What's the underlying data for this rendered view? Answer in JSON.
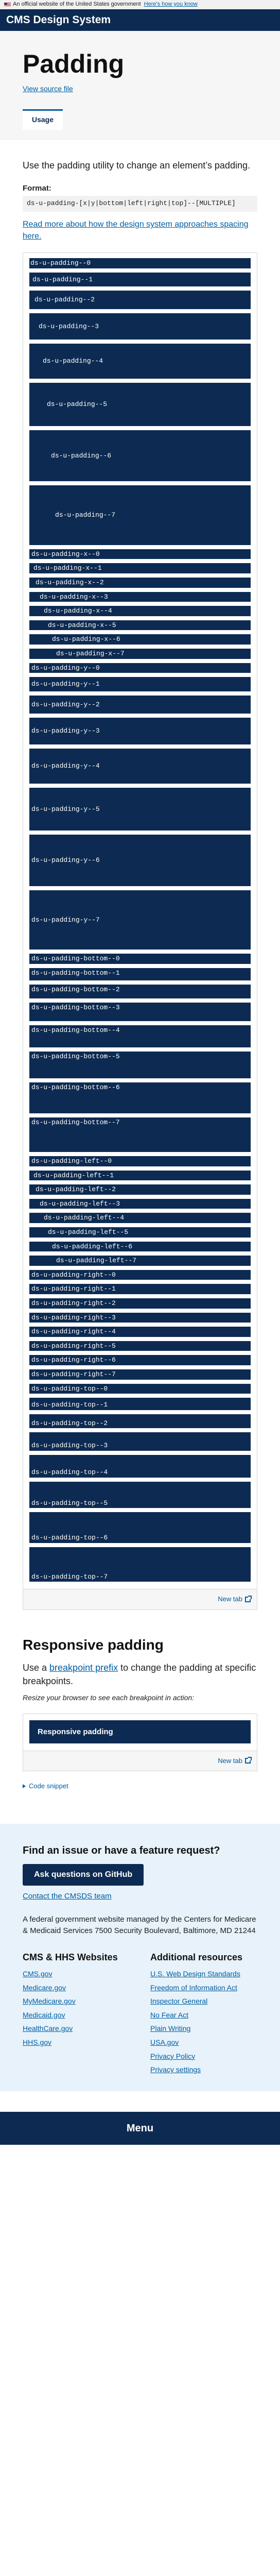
{
  "banner": {
    "text": "An official website of the United States government",
    "link": "Here's how you know"
  },
  "header": {
    "title": "CMS Design System"
  },
  "page": {
    "title": "Padding",
    "source_link": "View source file",
    "tab": "Usage"
  },
  "intro": {
    "lead": "Use the padding utility to change an element’s padding.",
    "format_label": "Format:",
    "format_code": "ds-u-padding-[x|y|bottom|left|right|top]--[MULTIPLE]",
    "approach_link": "Read more about how the design system approaches spacing here."
  },
  "demos": {
    "all": [
      "ds-u-padding--0",
      "ds-u-padding--1",
      "ds-u-padding--2",
      "ds-u-padding--3",
      "ds-u-padding--4",
      "ds-u-padding--5",
      "ds-u-padding--6",
      "ds-u-padding--7"
    ],
    "x": [
      "ds-u-padding-x--0",
      "ds-u-padding-x--1",
      "ds-u-padding-x--2",
      "ds-u-padding-x--3",
      "ds-u-padding-x--4",
      "ds-u-padding-x--5",
      "ds-u-padding-x--6",
      "ds-u-padding-x--7"
    ],
    "y": [
      "ds-u-padding-y--0",
      "ds-u-padding-y--1",
      "ds-u-padding-y--2",
      "ds-u-padding-y--3",
      "ds-u-padding-y--4",
      "ds-u-padding-y--5",
      "ds-u-padding-y--6",
      "ds-u-padding-y--7"
    ],
    "bottom": [
      "ds-u-padding-bottom--0",
      "ds-u-padding-bottom--1",
      "ds-u-padding-bottom--2",
      "ds-u-padding-bottom--3",
      "ds-u-padding-bottom--4",
      "ds-u-padding-bottom--5",
      "ds-u-padding-bottom--6",
      "ds-u-padding-bottom--7"
    ],
    "left": [
      "ds-u-padding-left--0",
      "ds-u-padding-left--1",
      "ds-u-padding-left--2",
      "ds-u-padding-left--3",
      "ds-u-padding-left--4",
      "ds-u-padding-left--5",
      "ds-u-padding-left--6",
      "ds-u-padding-left--7"
    ],
    "right": [
      "ds-u-padding-right--0",
      "ds-u-padding-right--1",
      "ds-u-padding-right--2",
      "ds-u-padding-right--3",
      "ds-u-padding-right--4",
      "ds-u-padding-right--5",
      "ds-u-padding-right--6",
      "ds-u-padding-right--7"
    ],
    "top": [
      "ds-u-padding-top--0",
      "ds-u-padding-top--1",
      "ds-u-padding-top--2",
      "ds-u-padding-top--3",
      "ds-u-padding-top--4",
      "ds-u-padding-top--5",
      "ds-u-padding-top--6",
      "ds-u-padding-top--7"
    ]
  },
  "example": {
    "new_tab": "New tab"
  },
  "responsive": {
    "heading": "Responsive padding",
    "lead_before": "Use a ",
    "lead_link": "breakpoint prefix",
    "lead_after": " to change the padding at specific breakpoints.",
    "note": "Resize your browser to see each breakpoint in action:",
    "box": "Responsive padding",
    "new_tab": "New tab",
    "code_snippet": "Code snippet"
  },
  "feedback": {
    "title": "Find an issue or have a feature request?",
    "button": "Ask questions on GitHub",
    "contact": "Contact the CMSDS team",
    "fed_text": "A federal government website managed by the Centers for Medicare & Medicaid Services 7500 Security Boulevard, Baltimore, MD 21244"
  },
  "footer": {
    "col1_title": "CMS & HHS Websites",
    "col1_links": [
      "CMS.gov",
      "Medicare.gov",
      "MyMedicare.gov",
      "Medicaid.gov",
      "HealthCare.gov",
      "HHS.gov"
    ],
    "col2_title": "Additional resources",
    "col2_links": [
      "U.S. Web Design Standards",
      "Freedom of Information Act",
      "Inspector General",
      "No Fear Act",
      "Plain Writing",
      "USA.gov",
      "Privacy Policy",
      "Privacy settings"
    ]
  },
  "menu": {
    "label": "Menu"
  },
  "colors": {
    "navy": "#0d2b52",
    "link": "#005ea2",
    "hero_bg": "#f6f6f6",
    "feedback_bg": "#e7f2fa"
  }
}
